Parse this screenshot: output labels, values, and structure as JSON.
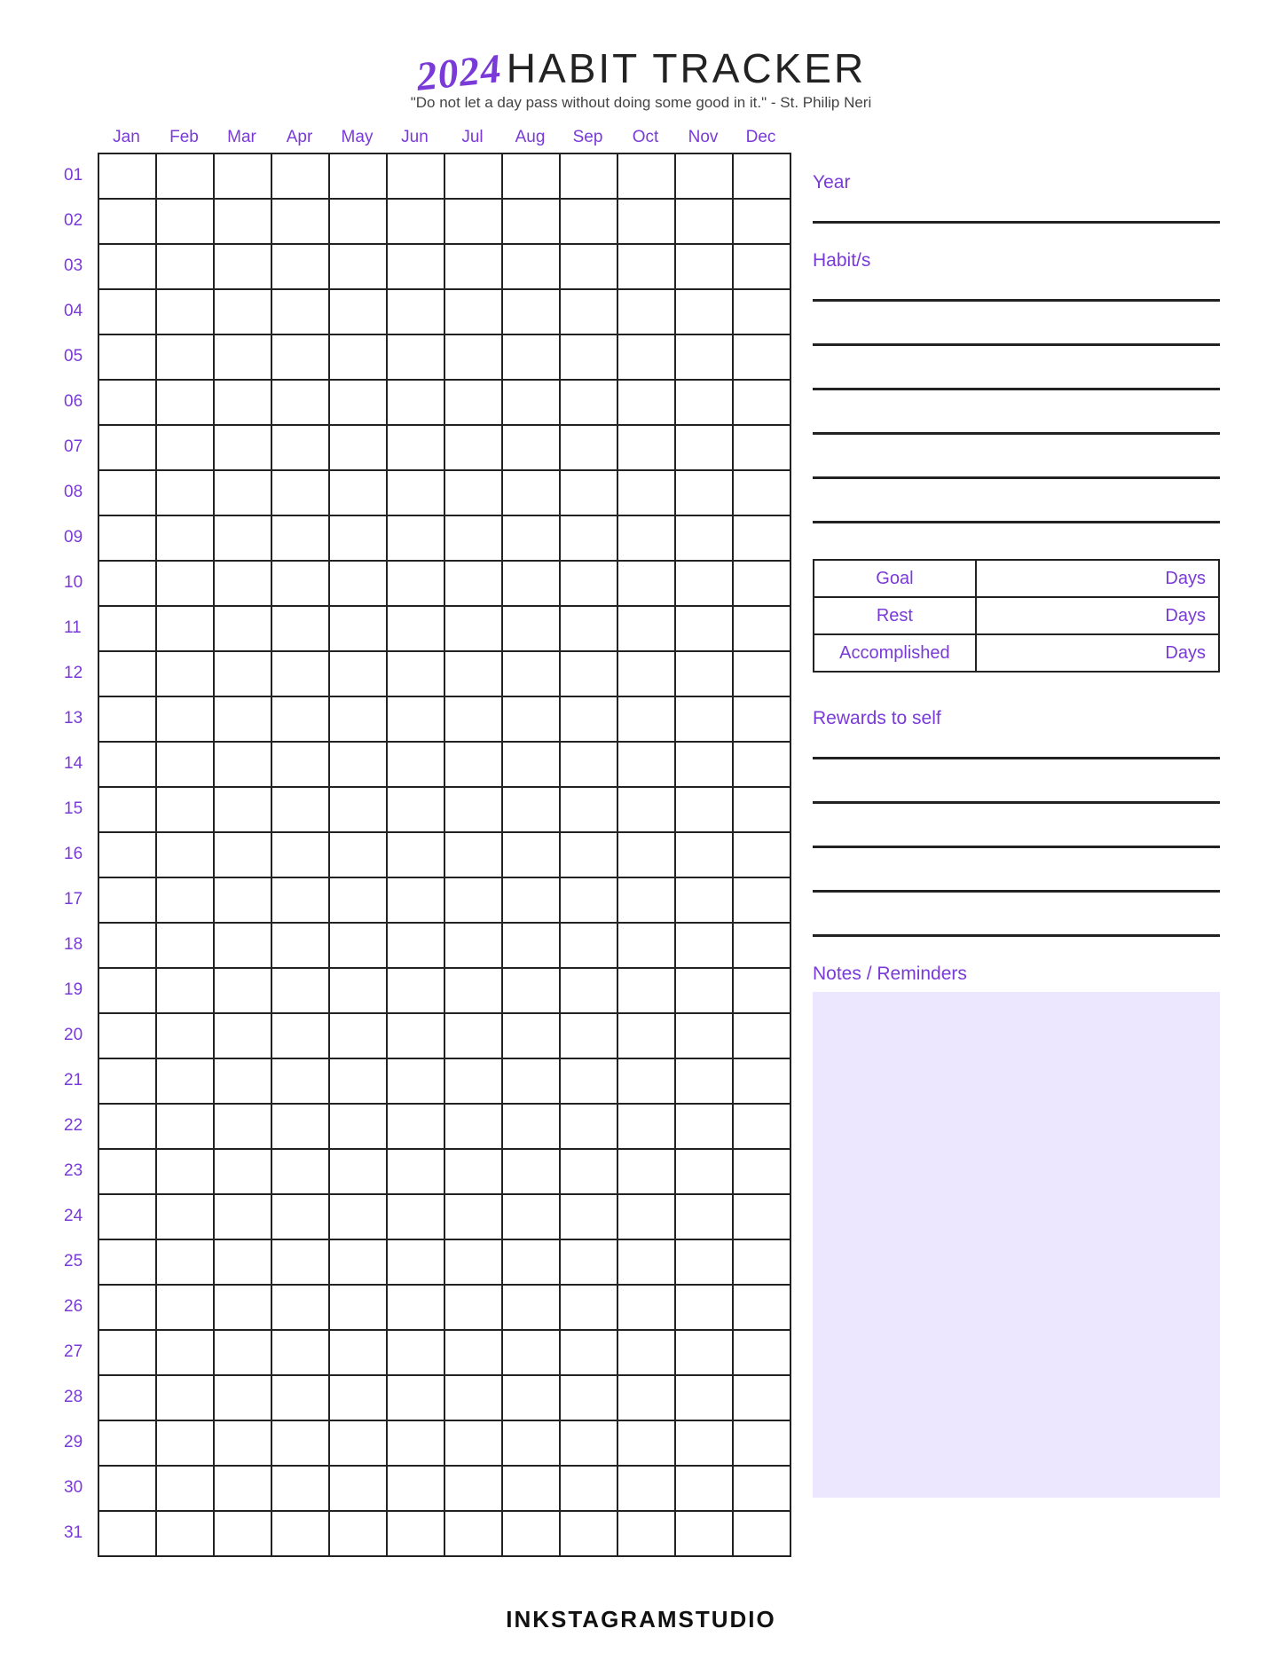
{
  "header": {
    "year_script": "2024",
    "title": "HABIT TRACKER",
    "subtitle": "\"Do not let a day pass without doing some good in it.\" - St. Philip Neri"
  },
  "months": [
    "Jan",
    "Feb",
    "Mar",
    "Apr",
    "May",
    "Jun",
    "Jul",
    "Aug",
    "Sep",
    "Oct",
    "Nov",
    "Dec"
  ],
  "days": [
    "01",
    "02",
    "03",
    "04",
    "05",
    "06",
    "07",
    "08",
    "09",
    "10",
    "11",
    "12",
    "13",
    "14",
    "15",
    "16",
    "17",
    "18",
    "19",
    "20",
    "21",
    "22",
    "23",
    "24",
    "25",
    "26",
    "27",
    "28",
    "29",
    "30",
    "31"
  ],
  "sidebar": {
    "year_label": "Year",
    "habits_label": "Habit/s",
    "goal_rows": [
      {
        "label": "Goal",
        "unit": "Days"
      },
      {
        "label": "Rest",
        "unit": "Days"
      },
      {
        "label": "Accomplished",
        "unit": "Days"
      }
    ],
    "rewards_label": "Rewards to self",
    "notes_label": "Notes / Reminders"
  },
  "footer": "INKSTAGRAMSTUDIO"
}
